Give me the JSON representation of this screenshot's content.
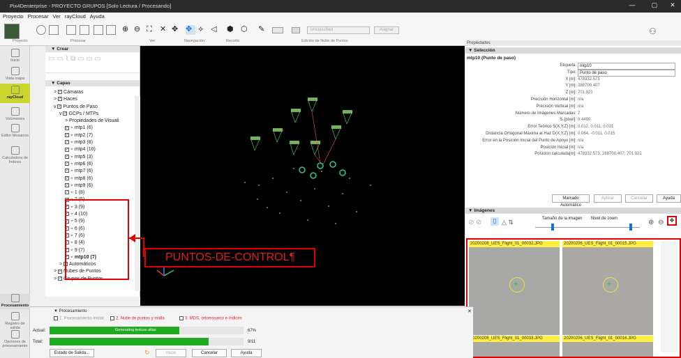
{
  "title": "Pix4Denterprise - PROYECTO GRUPOS [Solo Lectura / Procesando]",
  "menu": [
    "Proyecto",
    "Procesar",
    "Ver",
    "rayCloud",
    "Ayuda"
  ],
  "ribbon": {
    "groups": [
      "Proyecto",
      "Procesar",
      "Ver",
      "Navegación",
      "Recorte",
      "Edición de Nube de Puntos"
    ],
    "class_value": "Unclassified",
    "assign_label": "Asignar"
  },
  "sidebar": [
    {
      "label": "Inicio",
      "icon": "home-icon"
    },
    {
      "label": "Vista mapa",
      "icon": "map-icon"
    },
    {
      "label": "rayCloud",
      "icon": "raycloud-icon"
    },
    {
      "label": "Volúmenes",
      "icon": "volume-icon"
    },
    {
      "label": "Editor Mosaicos",
      "icon": "mosaic-icon"
    },
    {
      "label": "Calculadora de Índices",
      "icon": "index-calculator-icon"
    },
    {
      "label": "Procesamiento",
      "icon": "processing-icon"
    },
    {
      "label": "Registro de salida",
      "icon": "log-icon"
    },
    {
      "label": "Opciones de procesamiento",
      "icon": "settings-icon"
    }
  ],
  "layers": {
    "crear": "Crear",
    "capas": "Capas",
    "rows": [
      {
        "indent": 1,
        "label": "Cámaras",
        "arrow": ">"
      },
      {
        "indent": 1,
        "label": "Haces",
        "arrow": ">"
      },
      {
        "indent": 1,
        "label": "Puntos de Paso",
        "arrow": "v"
      },
      {
        "indent": 2,
        "label": "GCPs / MTPs",
        "arrow": "v"
      },
      {
        "indent": 3,
        "label": "Propiedades de Visuali",
        "arrow": ">",
        "nocb": true
      },
      {
        "indent": 3,
        "label": "mtp1 (6)"
      },
      {
        "indent": 3,
        "label": "mtp2 (7)"
      },
      {
        "indent": 3,
        "label": "mtp3 (8)"
      },
      {
        "indent": 3,
        "label": "mtp4 (10)"
      },
      {
        "indent": 3,
        "label": "mtp5 (3)"
      },
      {
        "indent": 3,
        "label": "mtp6 (6)"
      },
      {
        "indent": 3,
        "label": "mtp7 (6)"
      },
      {
        "indent": 3,
        "label": "mtp8 (6)"
      },
      {
        "indent": 3,
        "label": "mtp9 (6)"
      },
      {
        "indent": 3,
        "label": "1 (8)"
      },
      {
        "indent": 3,
        "label": "2 (5)"
      },
      {
        "indent": 3,
        "label": "3 (9)"
      },
      {
        "indent": 3,
        "label": "4 (10)"
      },
      {
        "indent": 3,
        "label": "5 (9)"
      },
      {
        "indent": 3,
        "label": "6 (6)"
      },
      {
        "indent": 3,
        "label": "7 (6)"
      },
      {
        "indent": 3,
        "label": "8 (4)"
      },
      {
        "indent": 3,
        "label": "9 (7)"
      },
      {
        "indent": 3,
        "label": "mtp10 (7)",
        "bold": true
      },
      {
        "indent": 2,
        "label": "Automáticos",
        "arrow": ">"
      },
      {
        "indent": 1,
        "label": "Nubes de Puntos",
        "arrow": ">"
      },
      {
        "indent": 1,
        "label": "Grupos de Puntos",
        "arrow": ">"
      }
    ]
  },
  "annotation": "PUNTOS-DE-CONTROL¶",
  "properties": {
    "header": "Propiedades",
    "section": "Selección",
    "subtitle": "mtp10 (Punto de paso)",
    "rows": [
      {
        "label": "Etiqueta:",
        "value": "mtp10"
      },
      {
        "label": "Tipo:",
        "value": "Punto de paso"
      },
      {
        "label": "X [m]:",
        "value": "478332.573"
      },
      {
        "label": "Y [m]:",
        "value": "288700.407"
      },
      {
        "label": "Z [m]:",
        "value": "701.921"
      },
      {
        "label": "Precisión Horizontal [m]:",
        "value": "n/a"
      },
      {
        "label": "Precisión Vertical [m]:",
        "value": "n/a"
      },
      {
        "label": "Número de Imágenes Marcadas:",
        "value": "7"
      },
      {
        "label": "S₀[pixel]:",
        "value": "0.4490"
      },
      {
        "label": "Error Teórico S(X,Y,Z) [m]:",
        "value": "0.012, 0.011, 0.031"
      },
      {
        "label": "Distancia Ortogonal Máxima al Haz D(X,Y,Z) [m]:",
        "value": "0.064, -0.011, 0.015"
      },
      {
        "label": "Error en la Posición Inicial del Punto de Apoyo [m]:",
        "value": "n/a"
      },
      {
        "label": "Posición Inicial [m]:",
        "value": "n/a"
      },
      {
        "label": "Posición calculada[m]:",
        "value": "478332.573, 288700.407, 701.921"
      }
    ],
    "buttons": {
      "auto": "Marcado Automático",
      "apply": "Aplicar",
      "cancel": "Cancelar",
      "help": "Ayuda"
    }
  },
  "images": {
    "section": "Imágenes",
    "size_label": "Tamaño de la imagen",
    "zoom_label": "Nivel de zoom",
    "size_level": 0.15,
    "zoom_level": 0.9,
    "thumbs": [
      "20200206_UES_Flight_01_00032.JPG",
      "20200206_UES_Flight_01_00015.JPG",
      "20200206_UES_Flight_01_00033.JPG",
      "20200206_UES_Flight_01_00016.JPG"
    ]
  },
  "processing": {
    "title": "Procesamiento",
    "steps": [
      "1. Procesamiento Inicial",
      "2. Nube de puntos y malla",
      "3. MDS, ortomosaico e índices"
    ],
    "actual_label": "Actual:",
    "actual_text": "Generating texture atlas",
    "actual_pct": "67%",
    "actual_value": 0.67,
    "total_label": "Total:",
    "total_text": "9/11",
    "total_value": 0.82,
    "output_status": "Estado de Salida...",
    "start": "Inicio",
    "cancel": "Cancelar",
    "help": "Ayuda"
  },
  "colors": {
    "accent": "#2c9e2c",
    "ribbon_active": "#c8d62e",
    "highlight": "#e00000",
    "progress": "#22aa22"
  }
}
